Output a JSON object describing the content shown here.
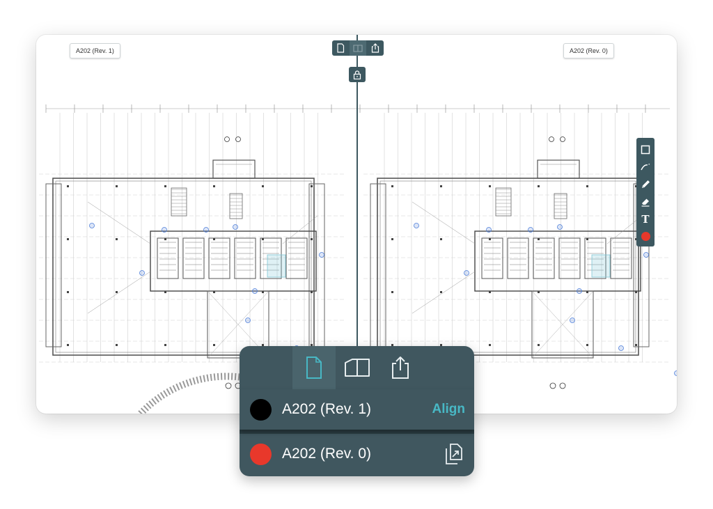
{
  "viewer": {
    "left_sheet_label": "A202 (Rev. 1)",
    "right_sheet_label": "A202 (Rev. 0)"
  },
  "top_toolbar": {
    "icons": [
      "single-page-icon",
      "split-view-icon",
      "share-icon"
    ],
    "active": "split-view-icon",
    "lock_icon": "lock-icon"
  },
  "side_toolbar": {
    "tools": [
      "rectangle-icon",
      "cloud-line-icon",
      "pencil-icon",
      "eraser-icon",
      "text-tool",
      "color-swatch"
    ],
    "text_tool_glyph": "T",
    "active_color": "#e8382b"
  },
  "compare_menu": {
    "tabs": [
      "single-page-icon",
      "split-view-icon",
      "share-icon"
    ],
    "active_tab": "single-page-icon",
    "rows": [
      {
        "color": "#000000",
        "label": "A202 (Rev. 1)",
        "action": "Align"
      },
      {
        "color": "#e8382b",
        "label": "A202 (Rev. 0)",
        "action_icon": "swap-sheets-icon"
      }
    ]
  },
  "colors": {
    "toolbar": "#3d5860",
    "menu_bg": "#40575f",
    "accent": "#48b8c5",
    "red": "#e8382b"
  }
}
